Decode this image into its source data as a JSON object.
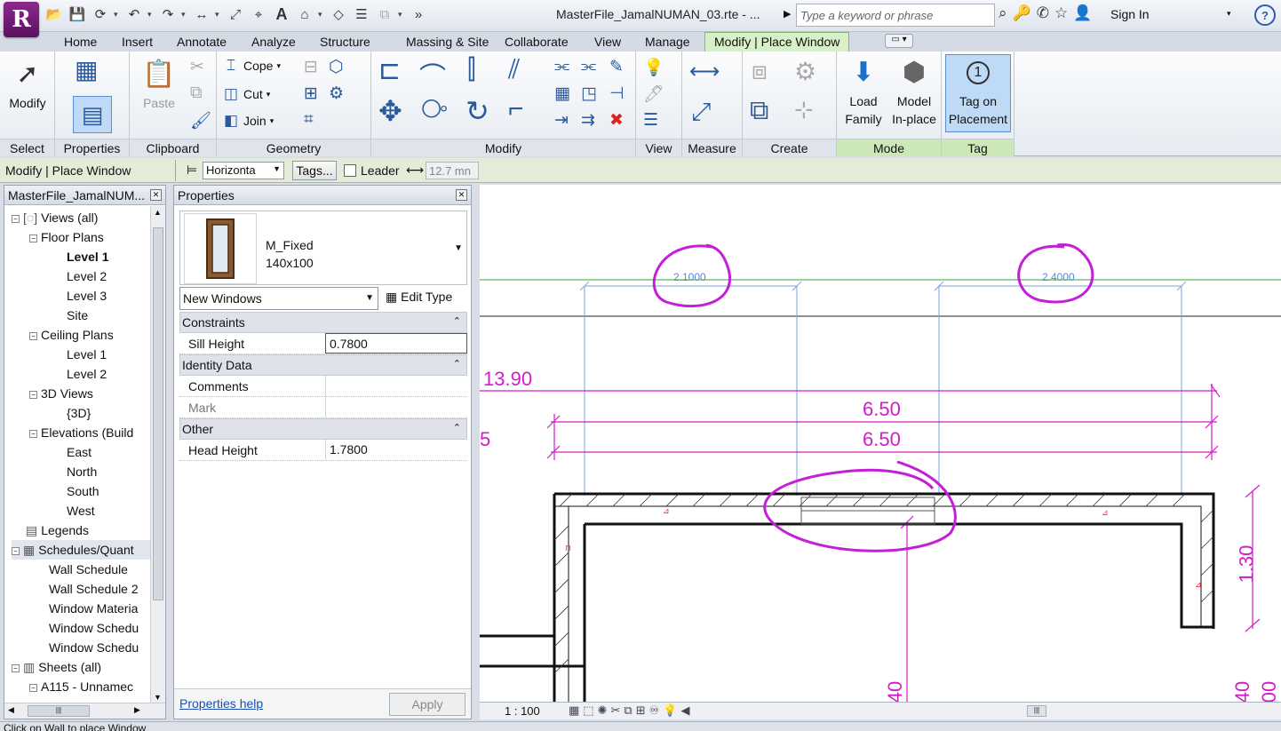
{
  "app": {
    "logo": "R",
    "title": "MasterFile_JamalNUMAN_03.rte - ...",
    "search_placeholder": "Type a keyword or phrase",
    "sign_in": "Sign In",
    "help": "?"
  },
  "tabs": [
    {
      "label": "Home"
    },
    {
      "label": "Insert"
    },
    {
      "label": "Annotate"
    },
    {
      "label": "Analyze"
    },
    {
      "label": "Structure"
    },
    {
      "label": "Massing & Site"
    },
    {
      "label": "Collaborate"
    },
    {
      "label": "View"
    },
    {
      "label": "Manage"
    },
    {
      "label": "Modify | Place Window"
    }
  ],
  "ribbon": {
    "select": {
      "label": "Select",
      "modify": "Modify"
    },
    "properties": {
      "label": "Properties"
    },
    "clipboard": {
      "label": "Clipboard",
      "paste": "Paste"
    },
    "geometry": {
      "label": "Geometry",
      "cope": "Cope",
      "cut": "Cut",
      "join": "Join"
    },
    "modify": {
      "label": "Modify"
    },
    "view": {
      "label": "View"
    },
    "measure": {
      "label": "Measure"
    },
    "create": {
      "label": "Create"
    },
    "mode": {
      "label": "Mode",
      "load_family_1": "Load",
      "load_family_2": "Family",
      "model_inplace_1": "Model",
      "model_inplace_2": "In-place"
    },
    "tag": {
      "label": "Tag",
      "tag_on_1": "Tag on",
      "tag_on_2": "Placement",
      "tag_num": "1"
    }
  },
  "options_bar": {
    "context": "Modify | Place Window",
    "orientation": "Horizonta",
    "tags_button": "Tags...",
    "leader_label": "Leader",
    "leader_length": "12.7 mn"
  },
  "browser": {
    "title": "MasterFile_JamalNUM...",
    "items": [
      {
        "label": "Views (all)",
        "toggle": "-"
      },
      {
        "label": "Floor Plans",
        "toggle": "-"
      },
      {
        "label": "Level 1"
      },
      {
        "label": "Level 2"
      },
      {
        "label": "Level 3"
      },
      {
        "label": "Site"
      },
      {
        "label": "Ceiling Plans",
        "toggle": "-"
      },
      {
        "label": "Level 1"
      },
      {
        "label": "Level 2"
      },
      {
        "label": "3D Views",
        "toggle": "-"
      },
      {
        "label": "{3D}"
      },
      {
        "label": "Elevations (Build",
        "toggle": "-"
      },
      {
        "label": "East"
      },
      {
        "label": "North"
      },
      {
        "label": "South"
      },
      {
        "label": "West"
      },
      {
        "label": "Legends"
      },
      {
        "label": "Schedules/Quant",
        "toggle": "-"
      },
      {
        "label": "Wall Schedule"
      },
      {
        "label": "Wall Schedule 2"
      },
      {
        "label": "Window Materia"
      },
      {
        "label": "Window Schedu"
      },
      {
        "label": "Window Schedu"
      },
      {
        "label": "Sheets (all)",
        "toggle": "-"
      },
      {
        "label": "A115 - Unnamec",
        "toggle": "-"
      }
    ]
  },
  "properties": {
    "title": "Properties",
    "family": "M_Fixed",
    "type": "140x100",
    "instance_selector": "New Windows",
    "edit_type": "Edit Type",
    "groups": {
      "constraints": "Constraints",
      "identity": "Identity Data",
      "other": "Other"
    },
    "rows": {
      "sill_label": "Sill Height",
      "sill_value": "0.7800",
      "comments_label": "Comments",
      "comments_value": "",
      "mark_label": "Mark",
      "mark_value": "",
      "head_label": "Head Height",
      "head_value": "1.7800"
    },
    "help": "Properties help",
    "apply": "Apply"
  },
  "canvas": {
    "dim_13_90": "13.90",
    "dim_6_50_a": "6.50",
    "dim_6_50_b": "6.50",
    "dim_5": "5",
    "dim_1_30": "1.30",
    "dim_40_a": "40",
    "dim_40_b": "40",
    "dim_00": "00",
    "temp_dim_1": "2.1000",
    "temp_dim_2": "2.4000",
    "annotation_color": "#d21cc8"
  },
  "view_bar": {
    "scale": "1 : 100"
  },
  "status": {
    "text": "Click on Wall to place Window"
  }
}
